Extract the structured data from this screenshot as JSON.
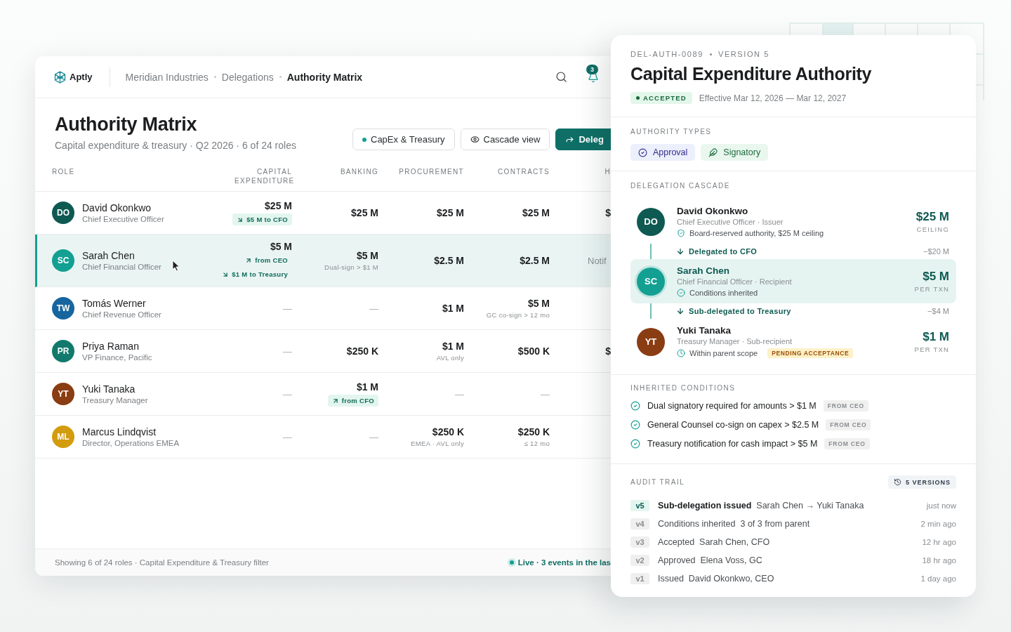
{
  "app": {
    "logo": "Aptly",
    "breadcrumbs": [
      {
        "label": "Meridian Industries",
        "selected": false
      },
      {
        "label": "Delegations",
        "selected": false
      },
      {
        "label": "Authority Matrix",
        "selected": true
      }
    ],
    "notification_count": "3"
  },
  "page": {
    "title": "Authority Matrix",
    "subtitle": "Capital expenditure & treasury · Q2 2026 · 6 of 24 roles",
    "actions": [
      {
        "kind": "filter",
        "label": "CapEx & Treasury"
      },
      {
        "kind": "view",
        "label": "Cascade view"
      },
      {
        "kind": "primary",
        "label": "Deleg"
      }
    ]
  },
  "table": {
    "role_header": "ROLE",
    "columns": [
      "CAPITAL EXPENDITURE",
      "BANKING",
      "PROCUREMENT",
      "CONTRACTS",
      "H"
    ],
    "rows": [
      {
        "initials": "DO",
        "color": "#0e5a52",
        "name": "David Okonkwo",
        "title": "Chief Executive Officer",
        "selected": false,
        "cells": [
          {
            "kind": "amount",
            "value": "$25 M",
            "tags": [
              {
                "kind": "out",
                "label": "$5 M to CFO"
              }
            ]
          },
          {
            "kind": "amount",
            "value": "$25 M"
          },
          {
            "kind": "amount",
            "value": "$25 M"
          },
          {
            "kind": "amount",
            "value": "$25 M"
          },
          {
            "kind": "amount",
            "value": "$"
          }
        ]
      },
      {
        "initials": "SC",
        "color": "#13a093",
        "name": "Sarah Chen",
        "title": "Chief Financial Officer",
        "selected": true,
        "cells": [
          {
            "kind": "amount",
            "value": "$5 M",
            "tags": [
              {
                "kind": "in",
                "label": "from CEO"
              },
              {
                "kind": "out",
                "label": "$1 M to Treasury"
              }
            ]
          },
          {
            "kind": "amount",
            "value": "$5 M",
            "note": "Dual-sign > $1 M"
          },
          {
            "kind": "amount",
            "value": "$2.5 M"
          },
          {
            "kind": "amount",
            "value": "$2.5 M"
          },
          {
            "kind": "text",
            "value": "Notif"
          }
        ]
      },
      {
        "initials": "TW",
        "color": "#17659e",
        "name": "Tomás Werner",
        "title": "Chief Revenue Officer",
        "selected": false,
        "cells": [
          {
            "kind": "none",
            "value": "—"
          },
          {
            "kind": "none",
            "value": "—"
          },
          {
            "kind": "amount",
            "value": "$1 M"
          },
          {
            "kind": "amount",
            "value": "$5 M",
            "note": "GC co-sign > 12 mo"
          }
        ]
      },
      {
        "initials": "PR",
        "color": "#127a6d",
        "name": "Priya Raman",
        "title": "VP Finance, Pacific",
        "selected": false,
        "cells": [
          {
            "kind": "none",
            "value": "—"
          },
          {
            "kind": "amount",
            "value": "$250 K"
          },
          {
            "kind": "amount",
            "value": "$1 M",
            "note": "AVL only"
          },
          {
            "kind": "amount",
            "value": "$500 K"
          },
          {
            "kind": "amount",
            "value": "$"
          }
        ]
      },
      {
        "initials": "YT",
        "color": "#8a3c12",
        "name": "Yuki Tanaka",
        "title": "Treasury Manager",
        "selected": false,
        "cells": [
          {
            "kind": "none",
            "value": "—"
          },
          {
            "kind": "amount",
            "value": "$1 M",
            "tags": [
              {
                "kind": "in",
                "label": "from CFO"
              }
            ]
          },
          {
            "kind": "none",
            "value": "—"
          },
          {
            "kind": "none",
            "value": "—"
          }
        ]
      },
      {
        "initials": "ML",
        "color": "#d39b0e",
        "name": "Marcus Lindqvist",
        "title": "Director, Operations EMEA",
        "selected": false,
        "cells": [
          {
            "kind": "none",
            "value": "—"
          },
          {
            "kind": "none",
            "value": "—"
          },
          {
            "kind": "amount",
            "value": "$250 K",
            "note": "EMEA · AVL only"
          },
          {
            "kind": "amount",
            "value": "$250 K",
            "note": "≤ 12 mo"
          }
        ]
      }
    ]
  },
  "footer": {
    "summary": "Showing 6 of 24 roles · Capital Expenditure & Treasury filter",
    "live": "Live · 3 events in the las"
  },
  "panel": {
    "reference": "DEL-AUTH-0089",
    "version": "VERSION 5",
    "title": "Capital Expenditure Authority",
    "status": "ACCEPTED",
    "effective": "Effective Mar 12, 2026 — Mar 12, 2027",
    "authority_types_label": "AUTHORITY TYPES",
    "authority_types": [
      {
        "kind": "approval",
        "label": "Approval"
      },
      {
        "kind": "signatory",
        "label": "Signatory"
      }
    ],
    "cascade_label": "DELEGATION CASCADE",
    "cascade": [
      {
        "kind": "person",
        "initials": "DO",
        "color": "#0e5a52",
        "name": "David Okonkwo",
        "role": "Chief Executive Officer · Issuer",
        "note": {
          "kind": "reserved",
          "text": "Board-reserved authority, $25 M ceiling"
        },
        "amount": "$25 M",
        "unit": "CEILING",
        "selected": false
      },
      {
        "kind": "link",
        "label": "Delegated to CFO",
        "delta": "−$20 M"
      },
      {
        "kind": "person",
        "initials": "SC",
        "color": "#13a093",
        "name": "Sarah Chen",
        "role": "Chief Financial Officer · Recipient",
        "note": {
          "kind": "inherited",
          "text": "Conditions inherited"
        },
        "amount": "$5 M",
        "unit": "PER TXN",
        "selected": true
      },
      {
        "kind": "link",
        "label": "Sub-delegated to Treasury",
        "delta": "−$4 M"
      },
      {
        "kind": "person",
        "initials": "YT",
        "color": "#8a3c12",
        "name": "Yuki Tanaka",
        "role": "Treasury Manager · Sub-recipient",
        "note": {
          "kind": "pending",
          "text": "Within parent scope"
        },
        "badge": "PENDING ACCEPTANCE",
        "amount": "$1 M",
        "unit": "PER TXN",
        "selected": false
      }
    ],
    "conditions_label": "INHERITED CONDITIONS",
    "conditions": [
      {
        "text": "Dual signatory required for amounts > $1 M",
        "source": "FROM CEO"
      },
      {
        "text": "General Counsel co-sign on capex > $2.5 M",
        "source": "FROM CEO"
      },
      {
        "text": "Treasury notification for cash impact > $5 M",
        "source": "FROM CEO"
      }
    ],
    "audit_label": "AUDIT TRAIL",
    "versions": "5 VERSIONS",
    "audit": [
      {
        "version": "v5",
        "selected": true,
        "action": "Sub-delegation issued",
        "detail": "Sarah Chen → Yuki Tanaka",
        "time": "just now"
      },
      {
        "version": "v4",
        "selected": false,
        "action": "Conditions inherited",
        "detail": "3 of 3 from parent",
        "time": "2 min ago"
      },
      {
        "version": "v3",
        "selected": false,
        "action": "Accepted",
        "detail": "Sarah Chen, CFO",
        "time": "12 hr ago"
      },
      {
        "version": "v2",
        "selected": false,
        "action": "Approved",
        "detail": "Elena Voss, GC",
        "time": "18 hr ago"
      },
      {
        "version": "v1",
        "selected": false,
        "action": "Issued",
        "detail": "David Okonkwo, CEO",
        "time": "1 day ago"
      }
    ]
  }
}
